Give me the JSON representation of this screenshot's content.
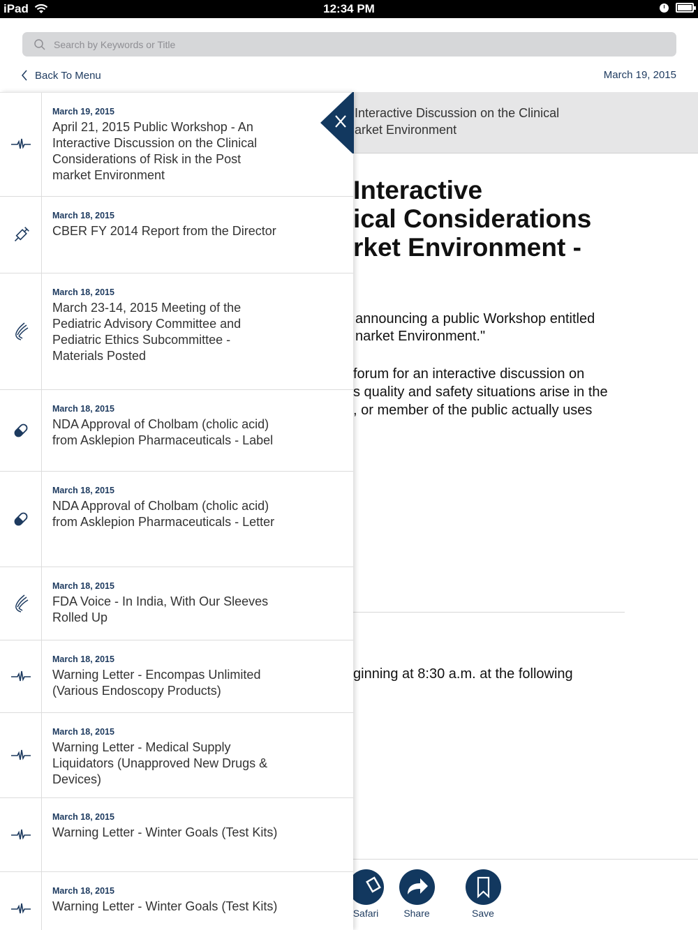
{
  "status_bar": {
    "device": "iPad",
    "time": "12:34 PM"
  },
  "search": {
    "placeholder": "Search by Keywords or Title"
  },
  "nav": {
    "back_label": "Back To Menu",
    "date": "March 19, 2015"
  },
  "detail": {
    "header_text": "Interactive Discussion on the Clinical\narket Environment",
    "title": "Interactive\nical Considerations\nrket Environment -",
    "para1": "announcing a public Workshop entitled\nnarket Environment.\"",
    "para2": "forum for an interactive discussion on\ns quality and safety situations arise in the\n, or member of the public actually uses",
    "para3": "ginning at 8:30 a.m. at the following",
    "actions": {
      "safari": "Safari",
      "share": "Share",
      "save": "Save"
    }
  },
  "list": [
    {
      "date": "March 19, 2015",
      "title": "April 21, 2015 Public Workshop - An Interactive Discussion on the Clinical Considerations of Risk in the Post market Environment",
      "icon": "pulse-icon"
    },
    {
      "date": "March 18, 2015",
      "title": "CBER FY 2014 Report from the Director",
      "icon": "syringe-icon"
    },
    {
      "date": "March 18, 2015",
      "title": "March 23-14, 2015 Meeting of the Pediatric Advisory Committee and Pediatric Ethics Subcommittee - Materials Posted",
      "icon": "hhs-eagle-icon"
    },
    {
      "date": "March 18, 2015",
      "title": "NDA Approval of Cholbam (cholic acid) from Asklepion Pharmaceuticals - Label",
      "icon": "pill-icon"
    },
    {
      "date": "March 18, 2015",
      "title": "NDA Approval of Cholbam (cholic acid) from Asklepion Pharmaceuticals - Letter",
      "icon": "pill-icon"
    },
    {
      "date": "March 18, 2015",
      "title": "FDA Voice - In India, With Our Sleeves Rolled Up",
      "icon": "hhs-eagle-icon"
    },
    {
      "date": "March 18, 2015",
      "title": "Warning Letter - Encompas Unlimited (Various Endoscopy Products)",
      "icon": "pulse-icon"
    },
    {
      "date": "March 18, 2015",
      "title": "Warning Letter - Medical Supply Liquidators (Unapproved New Drugs & Devices)",
      "icon": "pulse-icon"
    },
    {
      "date": "March 18, 2015",
      "title": "Warning Letter - Winter Goals (Test Kits)",
      "icon": "pulse-icon"
    },
    {
      "date": "March 18, 2015",
      "title": "Warning Letter - Winter Goals (Test Kits)",
      "icon": "pulse-icon"
    }
  ]
}
